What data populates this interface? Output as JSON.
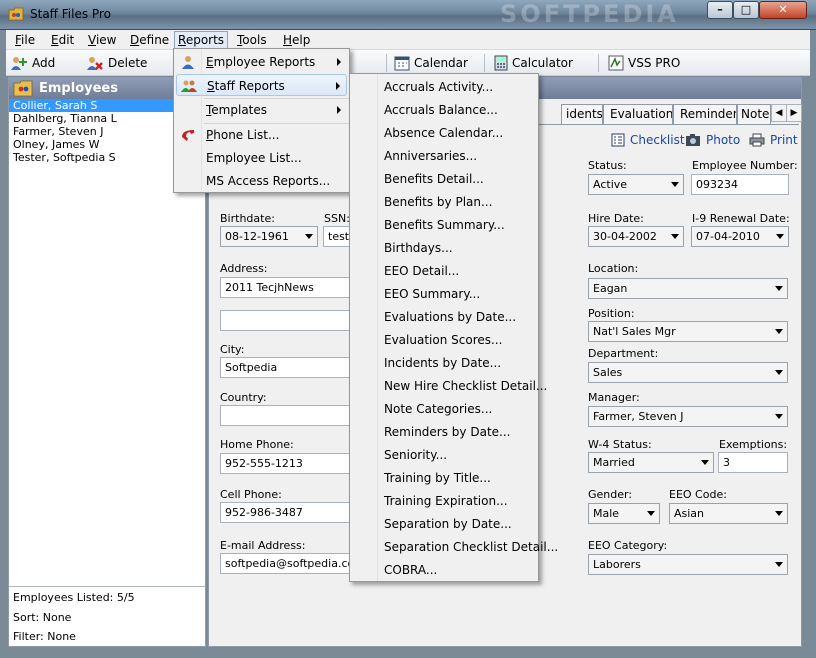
{
  "window": {
    "title": "Staff Files Pro",
    "watermark": "SOFTPEDIA",
    "min": "–",
    "max": "□",
    "close": "✕"
  },
  "menubar": [
    {
      "label": "File",
      "key": "F",
      "rest": "ile"
    },
    {
      "label": "Edit",
      "key": "E",
      "rest": "dit"
    },
    {
      "label": "View",
      "key": "V",
      "rest": "iew"
    },
    {
      "label": "Define",
      "key": "D",
      "rest": "efine"
    },
    {
      "label": "Reports",
      "key": "R",
      "rest": "eports"
    },
    {
      "label": "Tools",
      "key": "T",
      "rest": "ools"
    },
    {
      "label": "Help",
      "key": "H",
      "rest": "elp"
    }
  ],
  "toolbar": {
    "add": "Add",
    "delete": "Delete",
    "calendar": "Calendar",
    "calculator": "Calculator",
    "vss": "VSS PRO"
  },
  "left": {
    "header": "Employees",
    "employees": [
      "Collier, Sarah S",
      "Dahlberg, Tianna L",
      "Farmer, Steven J",
      "Olney, James W",
      "Tester, Softpedia S"
    ],
    "listed": "Employees Listed: 5/5",
    "sort": "Sort: None",
    "filter": "Filter: None"
  },
  "tabs": [
    "idents",
    "Evaluations",
    "Reminders",
    "Notes"
  ],
  "actions": {
    "checklist": "Checklist",
    "photo": "Photo",
    "print": "Print"
  },
  "form": {
    "birthdate_label": "Birthdate:",
    "birthdate": "08-12-1961",
    "ssn_label": "SSN:",
    "ssn": "teste",
    "address_label": "Address:",
    "address1": "2011 TecjhNews",
    "address2": "",
    "city_label": "City:",
    "city": "Softpedia",
    "country_label": "Country:",
    "country": "",
    "home_phone_label": "Home Phone:",
    "home_phone": "952-555-1213",
    "cell_phone_label": "Cell Phone:",
    "cell_phone": "952-986-3487",
    "email_label": "E-mail Address:",
    "email": "softpedia@softpedia.com",
    "status_label": "Status:",
    "status": "Active",
    "empnum_label": "Employee Number:",
    "empnum": "093234",
    "hire_label": "Hire Date:",
    "hire": "30-04-2002",
    "i9_label": "I-9 Renewal Date:",
    "i9": "07-04-2010",
    "location_label": "Location:",
    "location": "Eagan",
    "position_label": "Position:",
    "position": "Nat'l Sales Mgr",
    "department_label": "Department:",
    "department": "Sales",
    "manager_label": "Manager:",
    "manager": "Farmer, Steven J",
    "w4_label": "W-4 Status:",
    "w4": "Married",
    "exemptions_label": "Exemptions:",
    "exemptions": "3",
    "gender_label": "Gender:",
    "gender": "Male",
    "eeo_code_label": "EEO Code:",
    "eeo_code": "Asian",
    "eeo_cat_label": "EEO Category:",
    "eeo_cat": "Laborers"
  },
  "reports_menu": [
    {
      "label": "Employee Reports",
      "key": "E",
      "rest": "mployee Reports",
      "submenu": true
    },
    {
      "label": "Staff Reports",
      "key": "S",
      "rest": "taff Reports",
      "submenu": true
    },
    {
      "label": "Templates",
      "key": "T",
      "rest": "emplates",
      "submenu": true
    },
    {
      "label": "Phone List...",
      "key": "P",
      "rest": "hone List...",
      "submenu": false
    },
    {
      "label": "Employee List...",
      "key": "",
      "rest": "Employee List...",
      "submenu": false
    },
    {
      "label": "MS Access Reports...",
      "key": "",
      "rest": "MS Access Reports...",
      "submenu": false
    }
  ],
  "staff_reports": [
    "Accruals Activity...",
    "Accruals Balance...",
    "Absence Calendar...",
    "Anniversaries...",
    "Benefits Detail...",
    "Benefits by Plan...",
    "Benefits Summary...",
    "Birthdays...",
    "EEO Detail...",
    "EEO Summary...",
    "Evaluations by Date...",
    "Evaluation Scores...",
    "Incidents by Date...",
    "New Hire Checklist Detail...",
    "Note Categories...",
    "Reminders by Date...",
    "Seniority...",
    "Training by Title...",
    "Training Expiration...",
    "Separation by Date...",
    "Separation Checklist Detail...",
    "COBRA..."
  ],
  "colors": {
    "selection": "#3399ff",
    "header": "#7f8da7",
    "link": "#1a46a8"
  }
}
